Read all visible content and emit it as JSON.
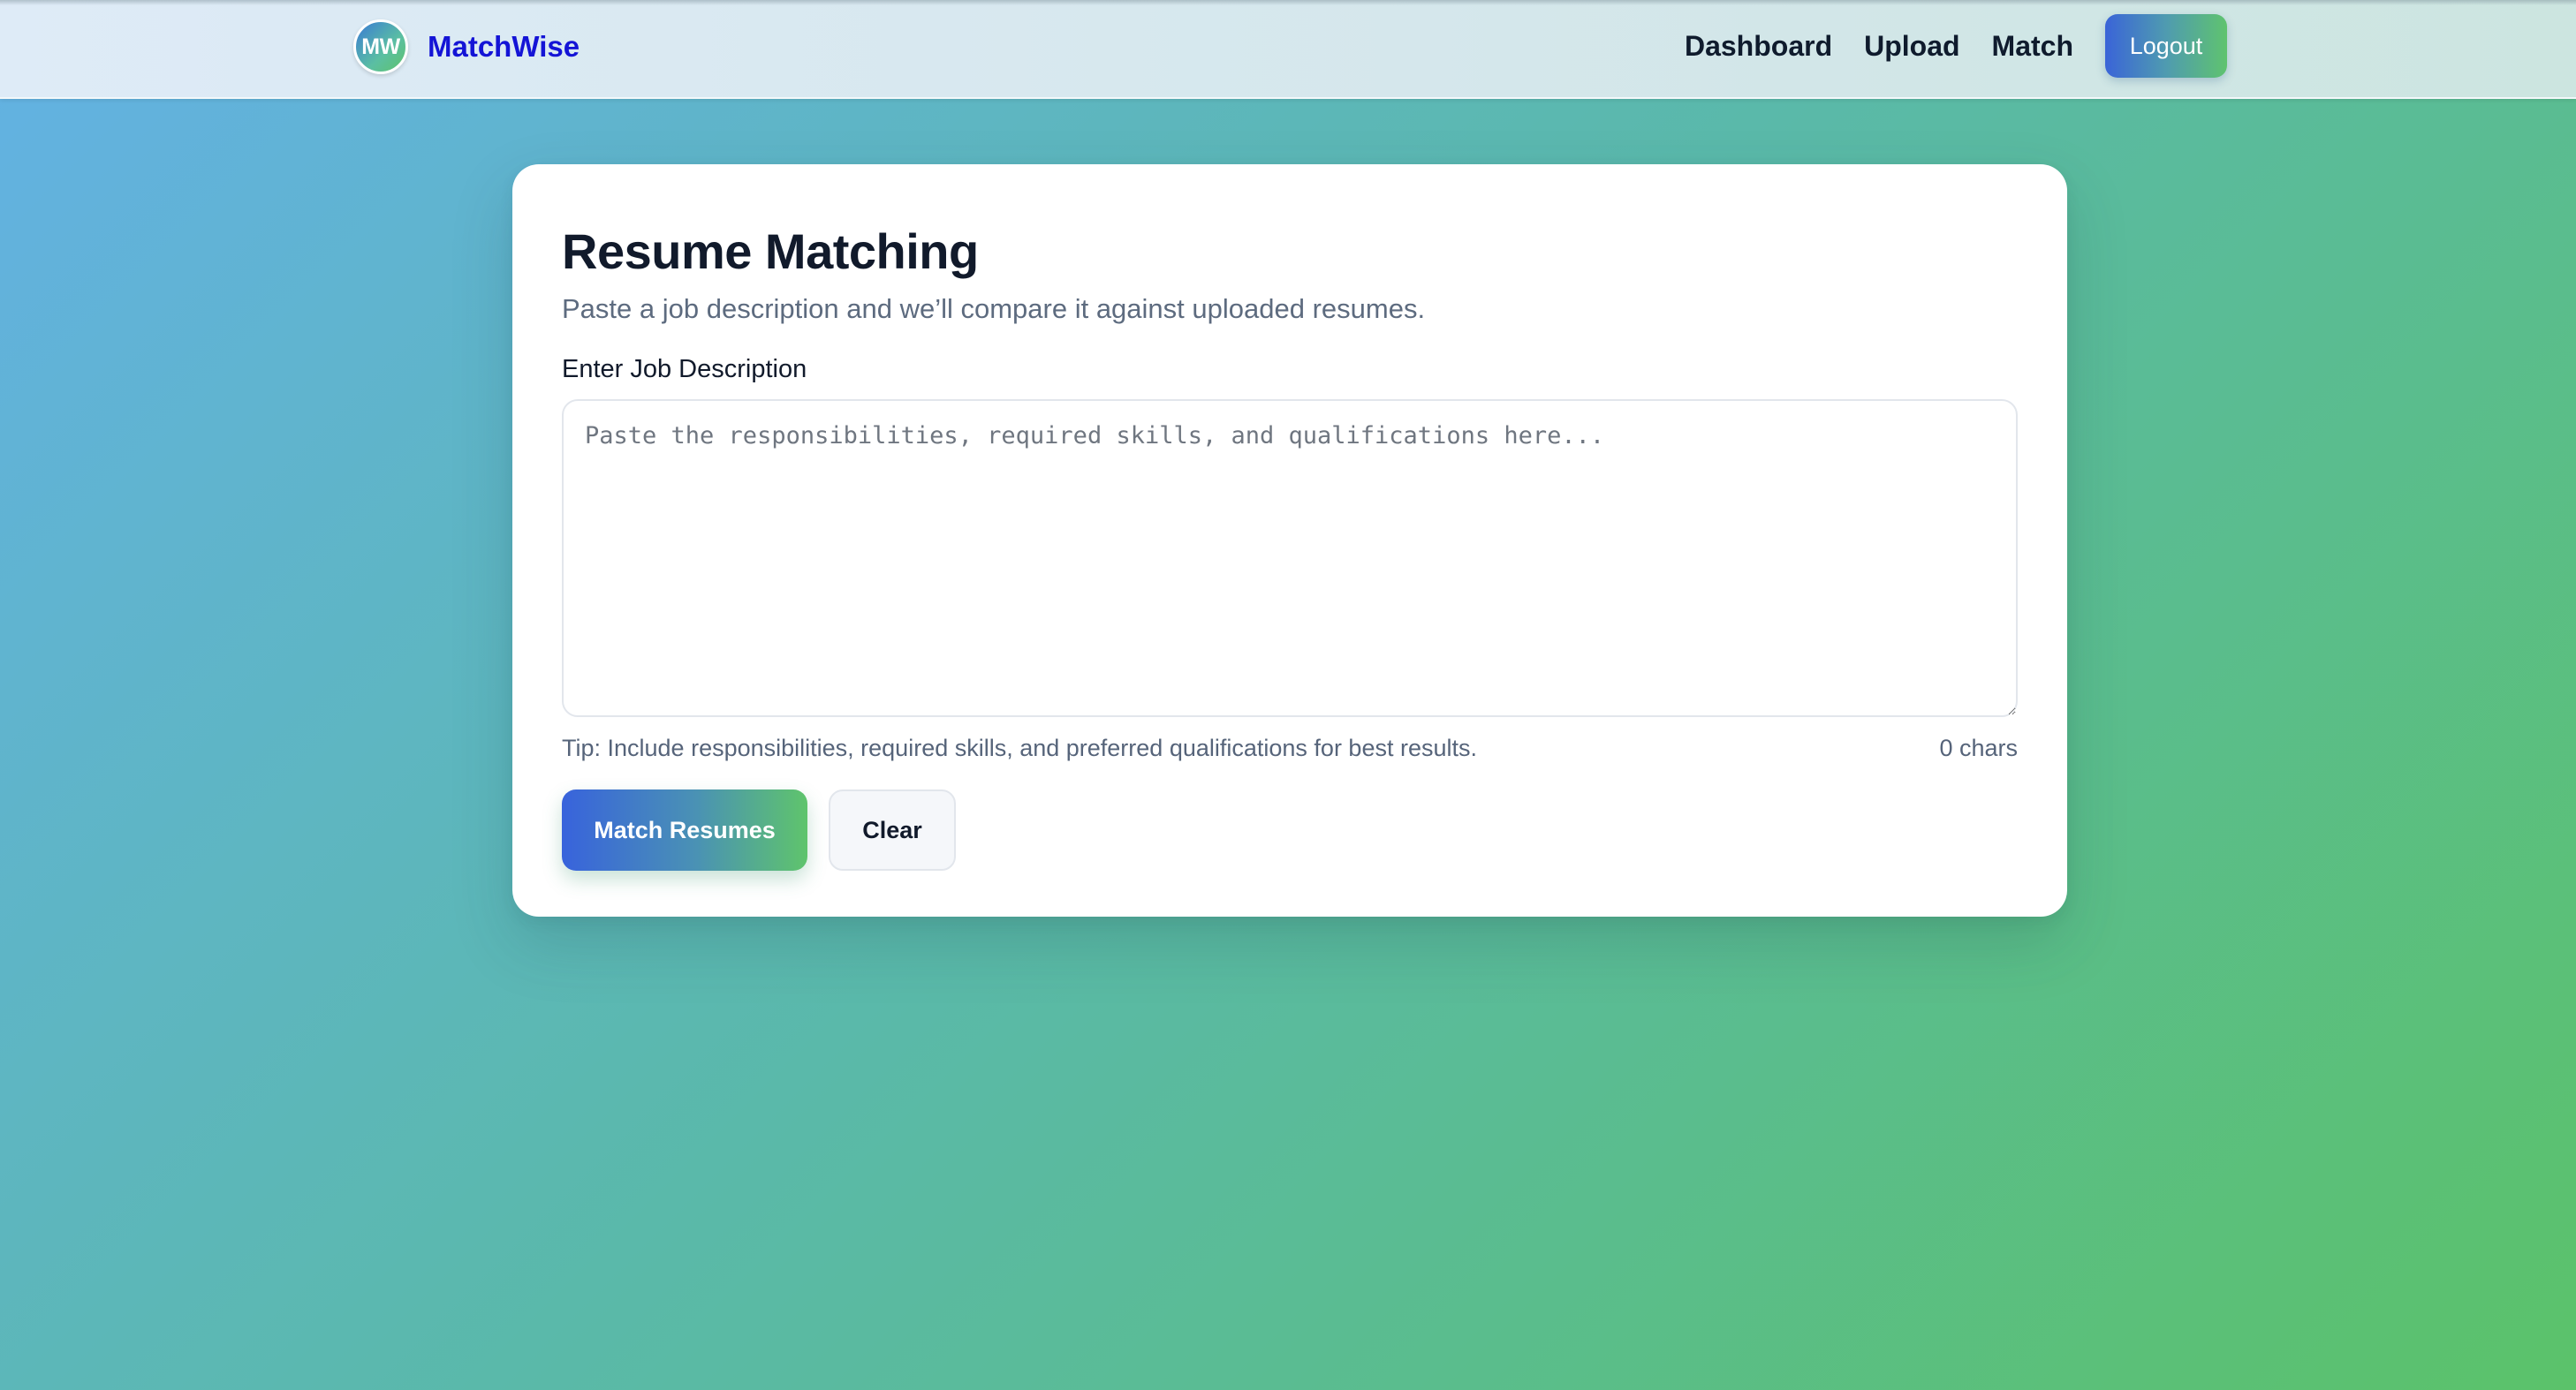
{
  "brand": {
    "logo_text": "MW",
    "name": "MatchWise"
  },
  "nav": {
    "links": [
      {
        "label": "Dashboard"
      },
      {
        "label": "Upload"
      },
      {
        "label": "Match"
      }
    ],
    "logout_label": "Logout"
  },
  "card": {
    "title": "Resume Matching",
    "subtitle": "Paste a job description and we’ll compare it against uploaded resumes.",
    "field_label": "Enter Job Description",
    "textarea_value": "",
    "textarea_placeholder": "Paste the responsibilities, required skills, and qualifications here...",
    "tip": "Tip: Include responsibilities, required skills, and preferred qualifications for best results.",
    "char_count": "0 chars",
    "match_button_label": "Match Resumes",
    "clear_button_label": "Clear"
  },
  "colors": {
    "brand_text": "#1414d6",
    "gradient_start": "#3863dc",
    "gradient_end": "#5fc46c",
    "title_text": "#111a2b",
    "muted_text": "#5d6b7f"
  }
}
